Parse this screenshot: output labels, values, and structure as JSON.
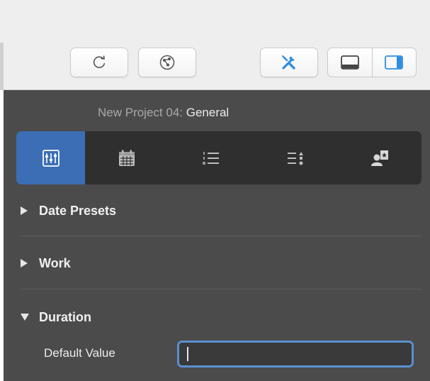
{
  "panel": {
    "project_name": "New Project 04:",
    "section_name": "General"
  },
  "toolbar": {
    "buttons": [
      "refresh-icon",
      "network-icon",
      "tools-icon",
      "bottom-panel-icon",
      "right-panel-icon"
    ]
  },
  "tabs": [
    {
      "name": "general",
      "icon": "sliders-icon",
      "active": true
    },
    {
      "name": "calendar",
      "icon": "calendar-icon",
      "active": false
    },
    {
      "name": "list",
      "icon": "list-icon",
      "active": false
    },
    {
      "name": "sort",
      "icon": "sort-list-icon",
      "active": false
    },
    {
      "name": "resource",
      "icon": "person-badge-icon",
      "active": false
    }
  ],
  "sections": {
    "date_presets": "Date Presets",
    "work": "Work",
    "duration": "Duration"
  },
  "duration": {
    "default_value_label": "Default Value",
    "default_value": ""
  },
  "colors": {
    "accent": "#3b6eb5",
    "panel_bg": "#4b4b4b",
    "tool_icon": "#2f8ee0"
  }
}
